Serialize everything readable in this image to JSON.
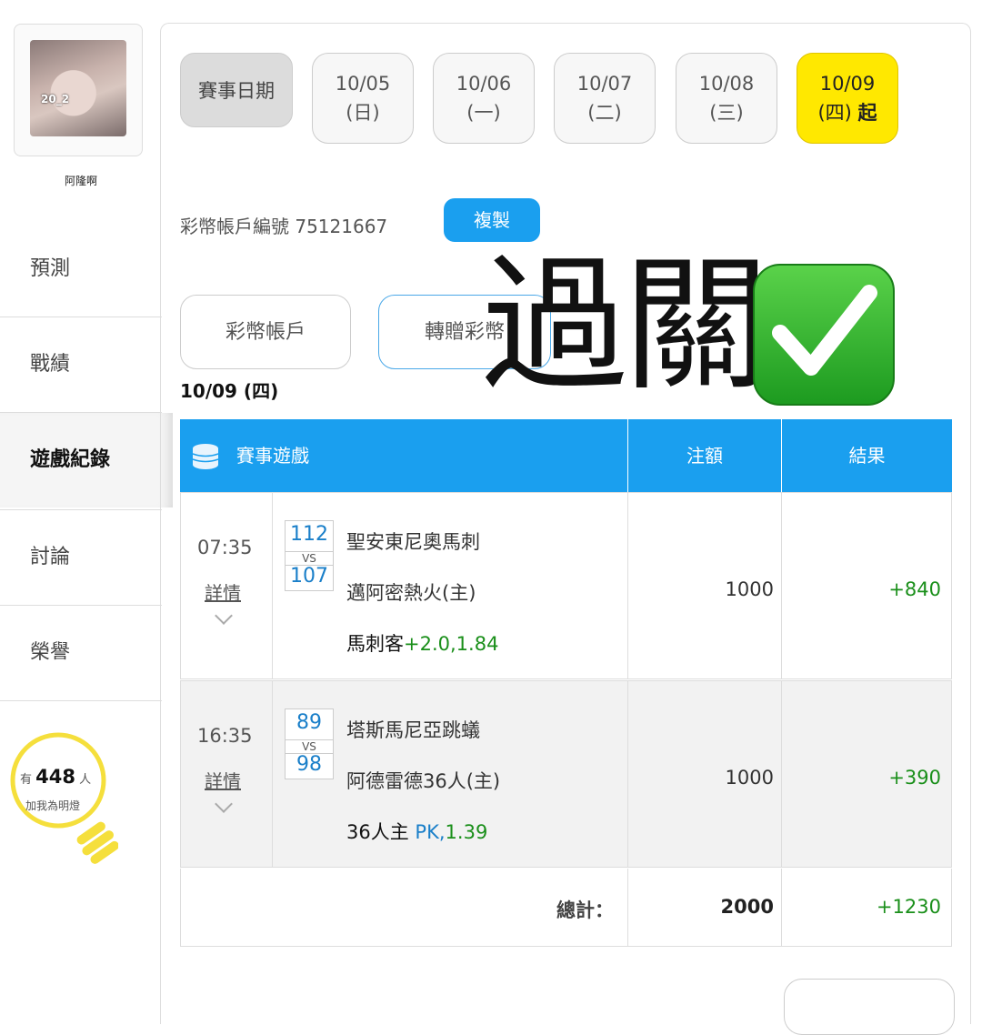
{
  "sidebar": {
    "username": "阿隆啊",
    "avatar_watermark": "20_2",
    "items": [
      {
        "label": "預測"
      },
      {
        "label": "戰績"
      },
      {
        "label": "遊戲紀錄"
      },
      {
        "label": "討論"
      },
      {
        "label": "榮譽"
      }
    ],
    "fans": {
      "prefix": "有",
      "count": "448",
      "suffix": "人",
      "line2": "加我為明燈"
    }
  },
  "dates": {
    "label": "賽事日期",
    "items": [
      {
        "date": "10/05",
        "day": "(日)"
      },
      {
        "date": "10/06",
        "day": "(一)"
      },
      {
        "date": "10/07",
        "day": "(二)"
      },
      {
        "date": "10/08",
        "day": "(三)"
      },
      {
        "date": "10/09",
        "day": "(四)",
        "suffix": "起"
      }
    ]
  },
  "account": {
    "text": "彩幣帳戶編號 75121667",
    "copy_label": "複製"
  },
  "tabs": {
    "coin_account": "彩幣帳戶",
    "transfer": "轉贈彩幣"
  },
  "overlay": {
    "text": "過關"
  },
  "current_date": "10/09 (四)",
  "table": {
    "headers": {
      "game": "賽事遊戲",
      "amount": "注額",
      "result": "結果"
    },
    "rows": [
      {
        "time": "07:35",
        "detail": "詳情",
        "away_score": "112",
        "vs": "VS",
        "home_score": "107",
        "away_team": "聖安東尼奧馬刺",
        "home_team": "邁阿密熱火(主)",
        "pick_team": "馬刺客",
        "pick_odds": "+2.0,1.84",
        "amount": "1000",
        "result": "+840"
      },
      {
        "time": "16:35",
        "detail": "詳情",
        "away_score": "89",
        "vs": "VS",
        "home_score": "98",
        "away_team": "塔斯馬尼亞跳蟻",
        "home_team": "阿德雷德36人(主)",
        "pick_team": "36人主",
        "pick_line": "PK,",
        "pick_odds": "1.39",
        "amount": "1000",
        "result": "+390"
      }
    ],
    "total": {
      "label": "總計：",
      "amount": "2000",
      "result": "+1230"
    }
  }
}
